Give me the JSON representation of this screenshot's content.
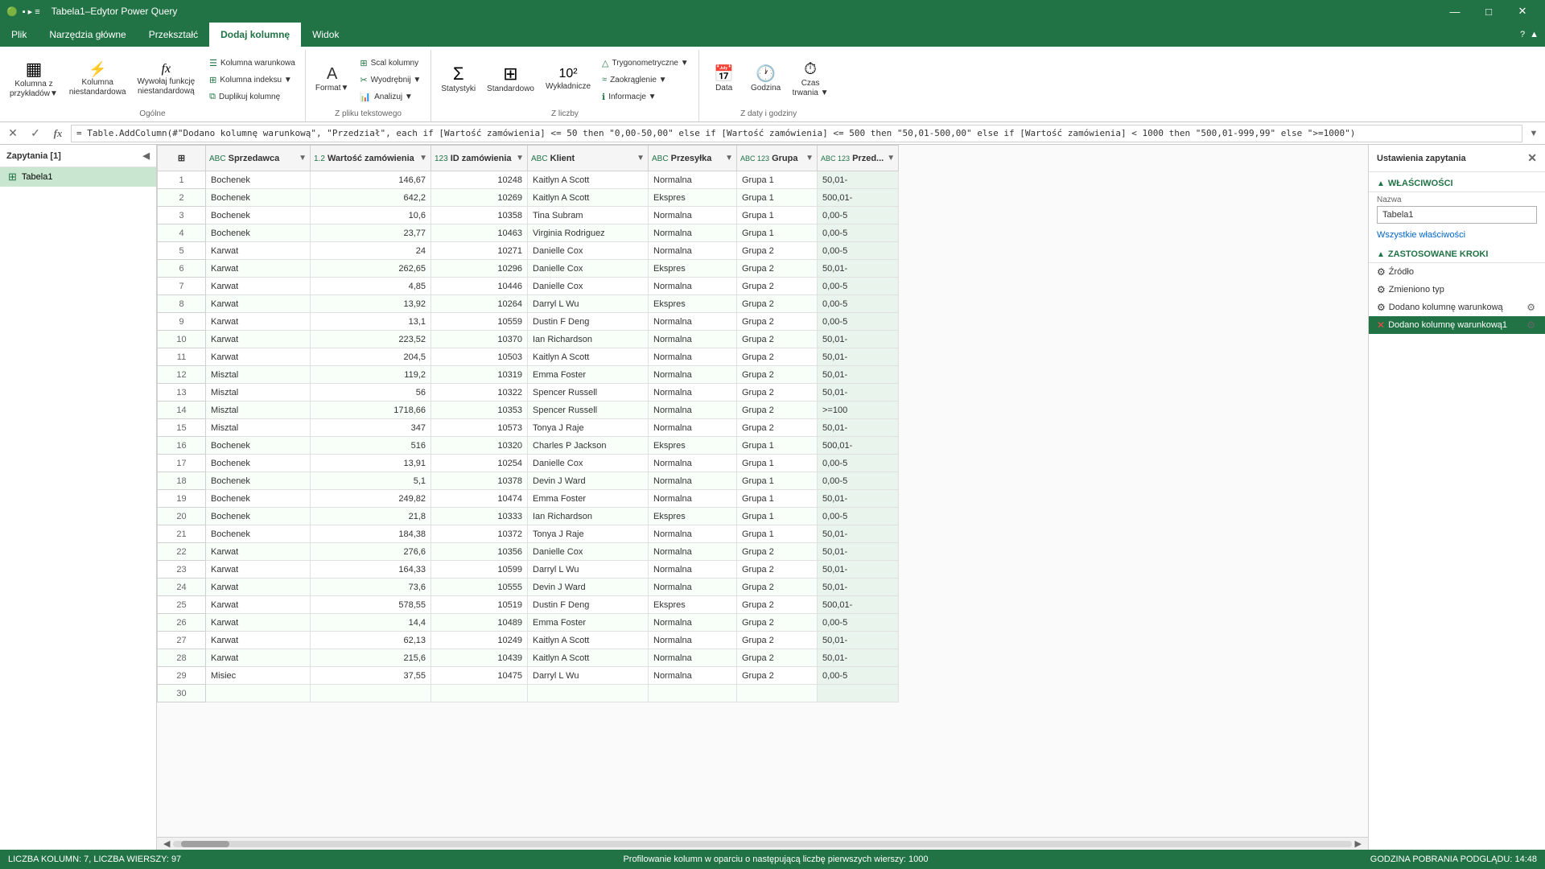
{
  "titleBar": {
    "icon": "🟢",
    "title": "Tabela1–Edytor Power Query",
    "controls": [
      "—",
      "□",
      "✕"
    ]
  },
  "ribbon": {
    "tabs": [
      "Plik",
      "Narzędzia główne",
      "Przekształć",
      "Dodaj kolumnę",
      "Widok"
    ],
    "activeTab": "Dodaj kolumnę",
    "groups": [
      {
        "label": "Ogólne",
        "buttons": [
          {
            "icon": "▦",
            "label": "Kolumna z\nprzykładów▼"
          },
          {
            "icon": "⚡",
            "label": "Kolumna\nniestandardowa"
          },
          {
            "icon": "fx",
            "label": "Wywołaj funkcję\nniestandardową"
          }
        ],
        "smallButtons": [
          "Kolumna warunkowa",
          "Kolumna indeksu ▼",
          "Duplikuj kolumnę"
        ]
      },
      {
        "label": "Z pliku tekstowego",
        "buttons": [
          {
            "icon": "A₁",
            "label": "Format▼"
          }
        ],
        "smallButtons": [
          "Scal kolumny",
          "Wyodrębnij ▼",
          "Analizuj ▼"
        ]
      },
      {
        "label": "Z liczby",
        "buttons": [
          {
            "icon": "Σ",
            "label": "Statystyki"
          },
          {
            "icon": "⊞",
            "label": "Standardowo"
          },
          {
            "icon": "10²",
            "label": "Wykładnicze"
          }
        ],
        "smallButtons": []
      },
      {
        "label": "Z daty i godziny",
        "buttons": [
          {
            "icon": "Δ",
            "label": "Zaokrąglenie ▼"
          },
          {
            "icon": "📅",
            "label": "Data"
          },
          {
            "icon": "🕐",
            "label": "Godzina"
          },
          {
            "icon": "⏱",
            "label": "Czas\ntrwania ▼"
          }
        ],
        "smallButtons": [
          "Trygonometryczne ▼",
          "Informacje ▼"
        ]
      }
    ]
  },
  "formulaBar": {
    "cancelBtn": "✕",
    "confirmBtn": "✓",
    "fxBtn": "fx",
    "formula": "= Table.AddColumn(#\"Dodano kolumnę warunkową\", \"Przedział\", each if [Wartość zamówienia] <= 50 then \"0,00-50,00\" else if [Wartość zamówienia] <= 500 then \"50,01-500,00\" else if [Wartość zamówienia] < 1000 then \"500,01-999,99\" else \">=1000\")",
    "expandBtn": "▼"
  },
  "queriesPanel": {
    "title": "Zapytania [1]",
    "queries": [
      {
        "name": "Tabela1",
        "selected": true
      }
    ]
  },
  "grid": {
    "columns": [
      {
        "label": "Sprzedawca",
        "type": "ABC"
      },
      {
        "label": "Wartość zamówienia",
        "type": "1.2"
      },
      {
        "label": "ID zamówienia",
        "type": "123"
      },
      {
        "label": "Klient",
        "type": "ABC"
      },
      {
        "label": "Przesyłka",
        "type": "ABC"
      },
      {
        "label": "Grupa",
        "type": "ABC 123"
      },
      {
        "label": "Przed...",
        "type": "ABC 123"
      }
    ],
    "rows": [
      [
        1,
        "Bochenek",
        "146,67",
        "10248",
        "Kaitlyn A Scott",
        "Normalna",
        "Grupa 1",
        "50,01-"
      ],
      [
        2,
        "Bochenek",
        "642,2",
        "10269",
        "Kaitlyn A Scott",
        "Ekspres",
        "Grupa 1",
        "500,01-"
      ],
      [
        3,
        "Bochenek",
        "10,6",
        "10358",
        "Tina Subram",
        "Normalna",
        "Grupa 1",
        "0,00-5"
      ],
      [
        4,
        "Bochenek",
        "23,77",
        "10463",
        "Virginia Rodriguez",
        "Normalna",
        "Grupa 1",
        "0,00-5"
      ],
      [
        5,
        "Karwat",
        "24",
        "10271",
        "Danielle Cox",
        "Normalna",
        "Grupa 2",
        "0,00-5"
      ],
      [
        6,
        "Karwat",
        "262,65",
        "10296",
        "Danielle Cox",
        "Ekspres",
        "Grupa 2",
        "50,01-"
      ],
      [
        7,
        "Karwat",
        "4,85",
        "10446",
        "Danielle Cox",
        "Normalna",
        "Grupa 2",
        "0,00-5"
      ],
      [
        8,
        "Karwat",
        "13,92",
        "10264",
        "Darryl L Wu",
        "Ekspres",
        "Grupa 2",
        "0,00-5"
      ],
      [
        9,
        "Karwat",
        "13,1",
        "10559",
        "Dustin F Deng",
        "Normalna",
        "Grupa 2",
        "0,00-5"
      ],
      [
        10,
        "Karwat",
        "223,52",
        "10370",
        "Ian Richardson",
        "Normalna",
        "Grupa 2",
        "50,01-"
      ],
      [
        11,
        "Karwat",
        "204,5",
        "10503",
        "Kaitlyn A Scott",
        "Normalna",
        "Grupa 2",
        "50,01-"
      ],
      [
        12,
        "Misztal",
        "119,2",
        "10319",
        "Emma Foster",
        "Normalna",
        "Grupa 2",
        "50,01-"
      ],
      [
        13,
        "Misztal",
        "56",
        "10322",
        "Spencer Russell",
        "Normalna",
        "Grupa 2",
        "50,01-"
      ],
      [
        14,
        "Misztal",
        "1718,66",
        "10353",
        "Spencer Russell",
        "Normalna",
        "Grupa 2",
        ">=100"
      ],
      [
        15,
        "Misztal",
        "347",
        "10573",
        "Tonya J Raje",
        "Normalna",
        "Grupa 2",
        "50,01-"
      ],
      [
        16,
        "Bochenek",
        "516",
        "10320",
        "Charles P Jackson",
        "Ekspres",
        "Grupa 1",
        "500,01-"
      ],
      [
        17,
        "Bochenek",
        "13,91",
        "10254",
        "Danielle Cox",
        "Normalna",
        "Grupa 1",
        "0,00-5"
      ],
      [
        18,
        "Bochenek",
        "5,1",
        "10378",
        "Devin J Ward",
        "Normalna",
        "Grupa 1",
        "0,00-5"
      ],
      [
        19,
        "Bochenek",
        "249,82",
        "10474",
        "Emma Foster",
        "Normalna",
        "Grupa 1",
        "50,01-"
      ],
      [
        20,
        "Bochenek",
        "21,8",
        "10333",
        "Ian Richardson",
        "Ekspres",
        "Grupa 1",
        "0,00-5"
      ],
      [
        21,
        "Bochenek",
        "184,38",
        "10372",
        "Tonya J Raje",
        "Normalna",
        "Grupa 1",
        "50,01-"
      ],
      [
        22,
        "Karwat",
        "276,6",
        "10356",
        "Danielle Cox",
        "Normalna",
        "Grupa 2",
        "50,01-"
      ],
      [
        23,
        "Karwat",
        "164,33",
        "10599",
        "Darryl L Wu",
        "Normalna",
        "Grupa 2",
        "50,01-"
      ],
      [
        24,
        "Karwat",
        "73,6",
        "10555",
        "Devin J Ward",
        "Normalna",
        "Grupa 2",
        "50,01-"
      ],
      [
        25,
        "Karwat",
        "578,55",
        "10519",
        "Dustin F Deng",
        "Ekspres",
        "Grupa 2",
        "500,01-"
      ],
      [
        26,
        "Karwat",
        "14,4",
        "10489",
        "Emma Foster",
        "Normalna",
        "Grupa 2",
        "0,00-5"
      ],
      [
        27,
        "Karwat",
        "62,13",
        "10249",
        "Kaitlyn A Scott",
        "Normalna",
        "Grupa 2",
        "50,01-"
      ],
      [
        28,
        "Karwat",
        "215,6",
        "10439",
        "Kaitlyn A Scott",
        "Normalna",
        "Grupa 2",
        "50,01-"
      ],
      [
        29,
        "Misiec",
        "37,55",
        "10475",
        "Darryl L Wu",
        "Normalna",
        "Grupa 2",
        "0,00-5"
      ],
      [
        30,
        "",
        "",
        "",
        "",
        "",
        "",
        ""
      ]
    ]
  },
  "rightPanel": {
    "title": "Ustawienia zapytania",
    "sections": {
      "properties": {
        "label": "WŁAŚCIWOŚCI",
        "nameLabel": "Nazwa",
        "nameValue": "Tabela1",
        "allPropsLink": "Wszystkie właściwości"
      },
      "steps": {
        "label": "ZASTOSOWANE KROKI",
        "items": [
          {
            "name": "Źródło",
            "active": false,
            "error": false,
            "hasSettings": false,
            "hasDelete": false
          },
          {
            "name": "Zmieniono typ",
            "active": false,
            "error": false,
            "hasSettings": false,
            "hasDelete": false
          },
          {
            "name": "Dodano kolumnę warunkową",
            "active": false,
            "error": false,
            "hasSettings": true,
            "hasDelete": false
          },
          {
            "name": "Dodano kolumnę warunkową1",
            "active": true,
            "error": true,
            "hasSettings": true,
            "hasDelete": true
          }
        ]
      }
    }
  },
  "statusBar": {
    "colCount": "LICZBA KOLUMN: 7, LICZBA WIERSZY: 97",
    "profilingInfo": "Profilowanie kolumn w oparciu o następującą liczbę pierwszych wierszy: 1000",
    "downloadTime": "GODZINA POBRANIA PODGLĄDU: 14:48"
  }
}
